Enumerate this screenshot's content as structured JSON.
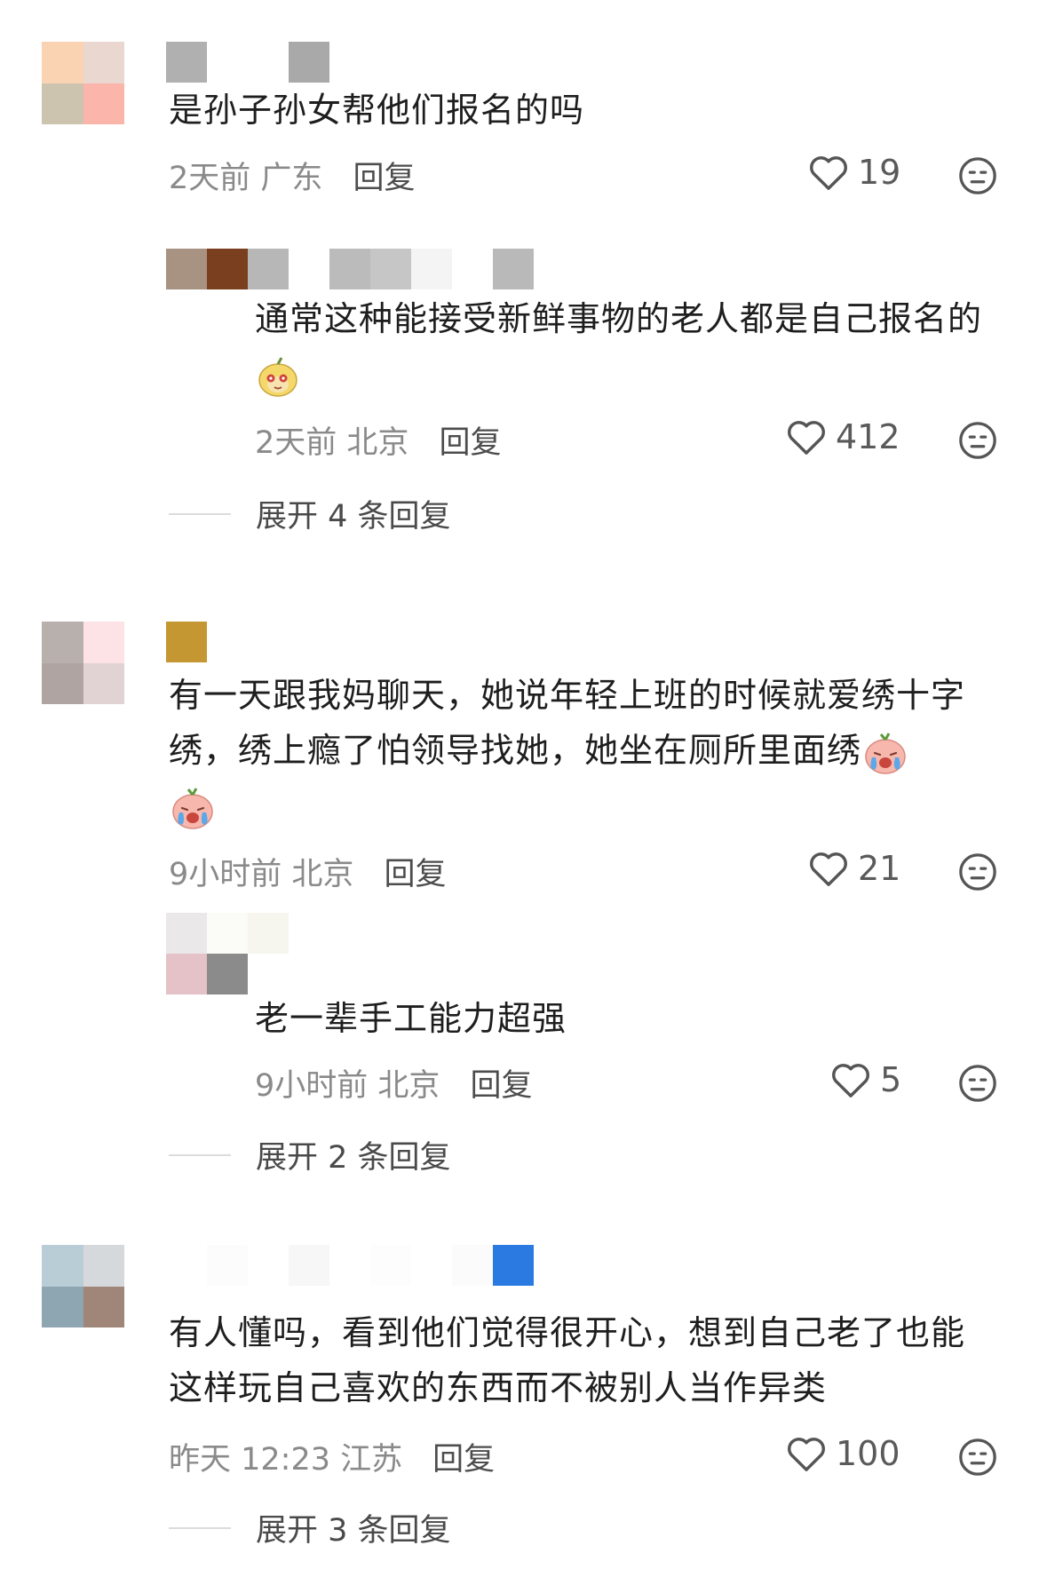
{
  "comments": [
    {
      "text": "是孙子孙女帮他们报名的吗",
      "time": "2天前",
      "location": "广东",
      "reply_label": "回复",
      "likes": "19",
      "avatar_colors": [
        "#f9d3b2",
        "#ead7cf",
        "#cdc4b0",
        "#fbb5ab"
      ],
      "name_colors": [
        "#b0b0b0",
        "#ffffff",
        "#ffffff",
        "#a9a9a9"
      ],
      "replies": [
        {
          "text": "通常这种能接受新鲜事物的老人都是自己报名的",
          "time": "2天前",
          "location": "北京",
          "reply_label": "回复",
          "likes": "412",
          "name_colors": [
            "#a89282",
            "#7a3f1e",
            "#b7b7b7",
            "#ffffff",
            "#bbbbbb",
            "#c6c6c6",
            "#f4f4f4",
            "#ffffff",
            "#b9b9b9"
          ]
        }
      ],
      "expand_label": "展开 4 条回复"
    },
    {
      "text": "有一天跟我妈聊天，她说年轻上班的时候就爱绣十字绣，绣上瘾了怕领导找她，她坐在厕所里面绣",
      "time": "9小时前",
      "location": "北京",
      "reply_label": "回复",
      "likes": "21",
      "avatar_colors": [
        "#b7b0ad",
        "#fde3e5",
        "#b0a4a2",
        "#e1d2d3"
      ],
      "name_colors": [
        "#c59733"
      ],
      "replies": [
        {
          "text": "老一辈手工能力超强",
          "time": "9小时前",
          "location": "北京",
          "reply_label": "回复",
          "likes": "5",
          "name_colors": [
            "#ebe8ea",
            "#fbfbf7",
            "#f6f6ee",
            "#e4c2c8",
            "#8b8b8b",
            "#ffffff"
          ]
        }
      ],
      "expand_label": "展开 2 条回复"
    },
    {
      "text": "有人懂吗，看到他们觉得很开心，想到自己老了也能这样玩自己喜欢的东西而不被别人当作异类",
      "time": "昨天 12:23",
      "location": "江苏",
      "reply_label": "回复",
      "likes": "100",
      "avatar_colors": [
        "#b8cdd5",
        "#d5d9db",
        "#8ea5b2",
        "#9f8678"
      ],
      "name_colors": [
        "#ffffff",
        "#fcfcfc",
        "#ffffff",
        "#f7f7f7",
        "#ffffff",
        "#fdfdfd",
        "#ffffff",
        "#fbfbfb",
        "#2b7ae2"
      ],
      "replies": [],
      "expand_label": "展开 3 条回复"
    }
  ],
  "icons": {
    "like": "heart-outline-icon",
    "dislike": "neutral-face-icon"
  }
}
